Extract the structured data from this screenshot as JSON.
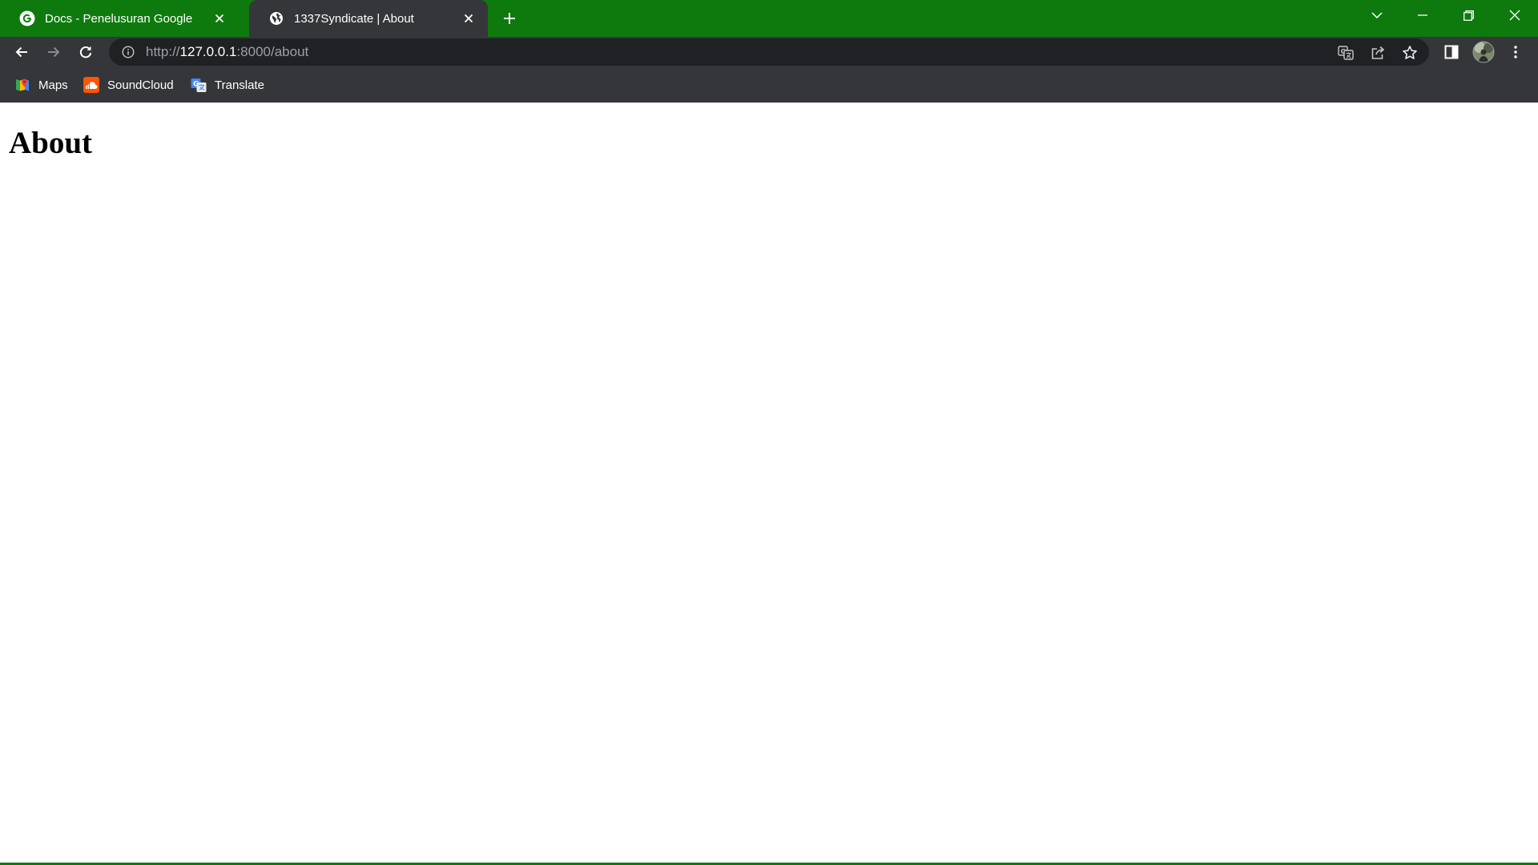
{
  "browser": {
    "frame_color": "#0e7a0d",
    "tabs": [
      {
        "title": "Docs - Penelusuran Google",
        "favicon": "google-g-icon",
        "active": false
      },
      {
        "title": "1337Syndicate | About",
        "favicon": "globe-icon",
        "active": true
      }
    ],
    "url": {
      "scheme": "http://",
      "host": "127.0.0.1",
      "rest": ":8000/about"
    },
    "bookmarks": [
      {
        "label": "Maps",
        "icon": "maps-icon"
      },
      {
        "label": "SoundCloud",
        "icon": "soundcloud-icon"
      },
      {
        "label": "Translate",
        "icon": "translate-icon"
      }
    ]
  },
  "page": {
    "heading": "About"
  }
}
